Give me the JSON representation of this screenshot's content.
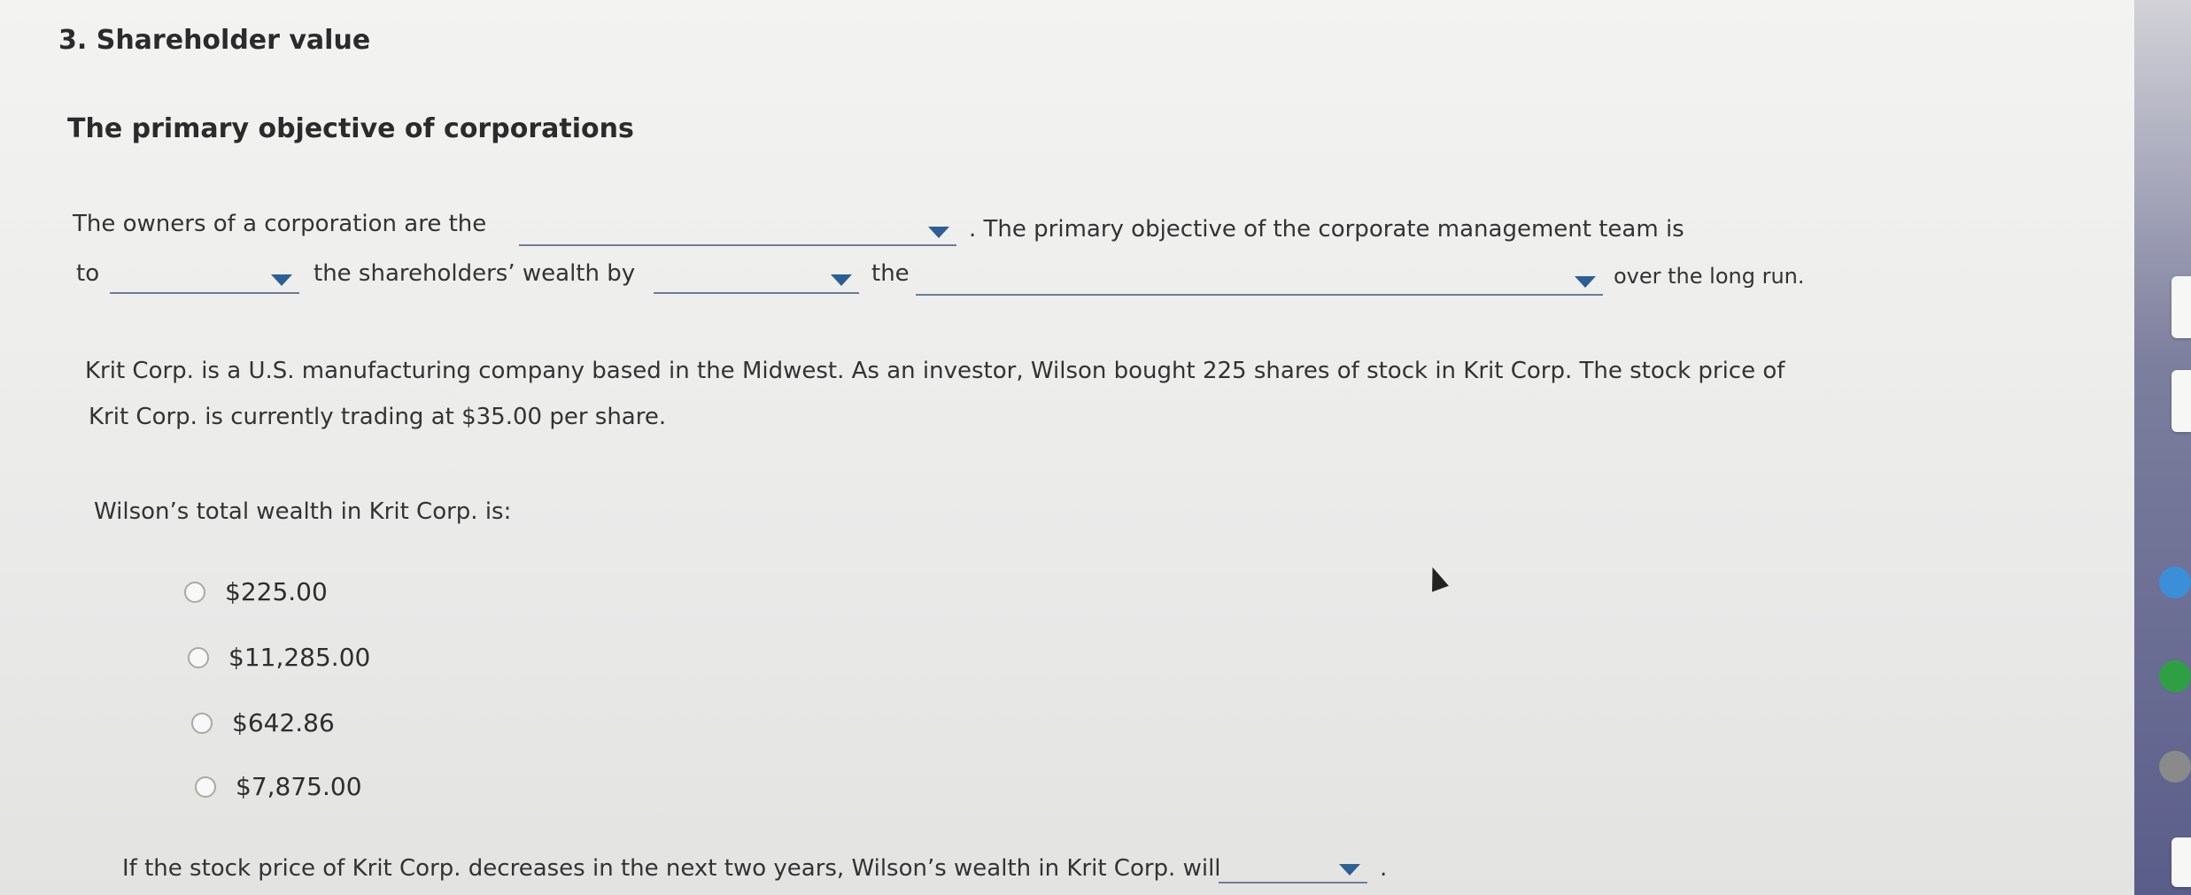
{
  "question": {
    "title": "3. Shareholder value",
    "section_title": "The primary objective of corporations"
  },
  "fill_in": {
    "line1_start": "The owners of a corporation are the",
    "line1_end": ". The primary objective of the corporate management team is",
    "line2_to": "to",
    "line2_mid": "the shareholders’ wealth by",
    "line2_the": "the",
    "line2_end": "over the long run.",
    "dropdowns": [
      {
        "selected": ""
      },
      {
        "selected": ""
      },
      {
        "selected": ""
      },
      {
        "selected": ""
      }
    ]
  },
  "scenario": {
    "line1": "Krit Corp. is a U.S. manufacturing company based in the Midwest. As an investor, Wilson bought 225 shares of stock in Krit Corp. The stock price of",
    "line2": "Krit Corp. is currently trading at $35.00 per share."
  },
  "wealth_question": {
    "prompt": "Wilson’s total wealth in Krit Corp. is:",
    "options": [
      {
        "label": "$225.00",
        "selected": false
      },
      {
        "label": "$11,285.00",
        "selected": false
      },
      {
        "label": "$642.86",
        "selected": false
      },
      {
        "label": "$7,875.00",
        "selected": false
      }
    ]
  },
  "followup": {
    "text": "If the stock price of Krit Corp. decreases in the next two years, Wilson’s wealth in Krit Corp. will",
    "dropdown_selected": "",
    "end": "."
  },
  "colors": {
    "caret": "#2c5f95",
    "underline": "#6b7d94",
    "page_background": "#efefee",
    "rail": "#5a5d89"
  }
}
